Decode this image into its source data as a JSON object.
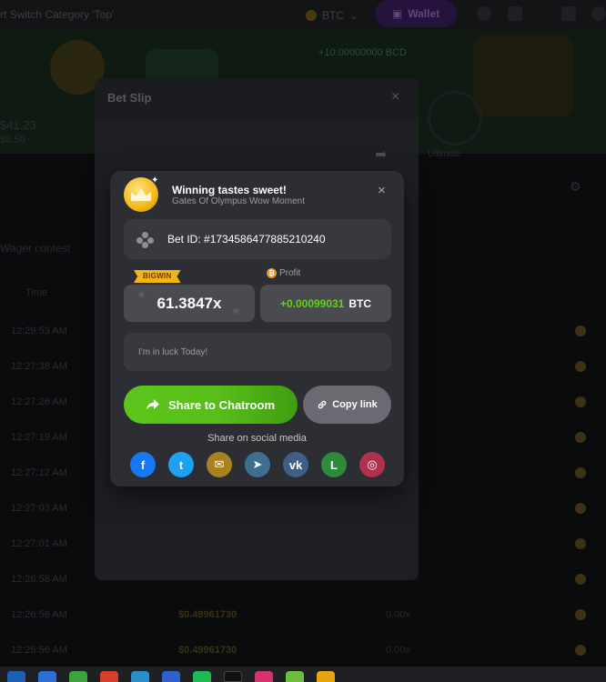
{
  "background": {
    "breadcrumb": "rt Switch   Category 'Top'",
    "currency": "BTC",
    "wallet_label": "Wallet",
    "banner_text": "+10.00000000 BCD",
    "amount_big": "$41.23",
    "amount_small": "$8.50",
    "side_label": "Ultimate",
    "wager_label": "Wager contest",
    "column_label": "Time",
    "rows": [
      {
        "time": "12:29:53 AM",
        "amount": "",
        "zero": ""
      },
      {
        "time": "12:27:38 AM",
        "amount": "",
        "zero": ""
      },
      {
        "time": "12:27:26 AM",
        "amount": "",
        "zero": ""
      },
      {
        "time": "12:27:19 AM",
        "amount": "",
        "zero": ""
      },
      {
        "time": "12:27:12 AM",
        "amount": "",
        "zero": ""
      },
      {
        "time": "12:27:03 AM",
        "amount": "",
        "zero": ""
      },
      {
        "time": "12:27:01 AM",
        "amount": "",
        "zero": ""
      },
      {
        "time": "12:26:58 AM",
        "amount": "",
        "zero": ""
      },
      {
        "time": "12:26:56 AM",
        "amount": "$0.49961730",
        "zero": "0.00x"
      },
      {
        "time": "12:26:56 AM",
        "amount": "$0.49961730",
        "zero": "0.00x"
      }
    ]
  },
  "bet_slip": {
    "title": "Bet Slip",
    "close_glyph": "×"
  },
  "share_modal": {
    "title": "Winning tastes sweet!",
    "subtitle": "Gates Of Olympus Wow Moment",
    "close_glyph": "×",
    "bet_id_text": "Bet ID: #1734586477885210240",
    "bigwin_badge": "BIGWIN",
    "profit_label": "Profit",
    "multiplier": "61.3847x",
    "profit_value": "+0.00099031",
    "profit_currency": "BTC",
    "message_placeholder": "I'm in luck Today!",
    "share_button_label": "Share to Chatroom",
    "copy_button_label": "Copy link",
    "social_label": "Share on social media",
    "social": [
      {
        "name": "facebook",
        "glyph": "f",
        "color": "#1877f2"
      },
      {
        "name": "twitter",
        "glyph": "t",
        "color": "#1da1f2"
      },
      {
        "name": "email",
        "glyph": "✉",
        "color": "#a88120"
      },
      {
        "name": "telegram",
        "glyph": "➤",
        "color": "#3f6f8f"
      },
      {
        "name": "vk",
        "glyph": "vk",
        "color": "#3f5f86"
      },
      {
        "name": "line",
        "glyph": "L",
        "color": "#2e8b3a"
      },
      {
        "name": "instagram",
        "glyph": "◎",
        "color": "#b0304f"
      }
    ]
  },
  "colors": {
    "accent_green": "#5cc51b",
    "profit_green": "#61d11c",
    "badge_gold": "#f2b518",
    "modal_bg": "#2d2e33"
  }
}
